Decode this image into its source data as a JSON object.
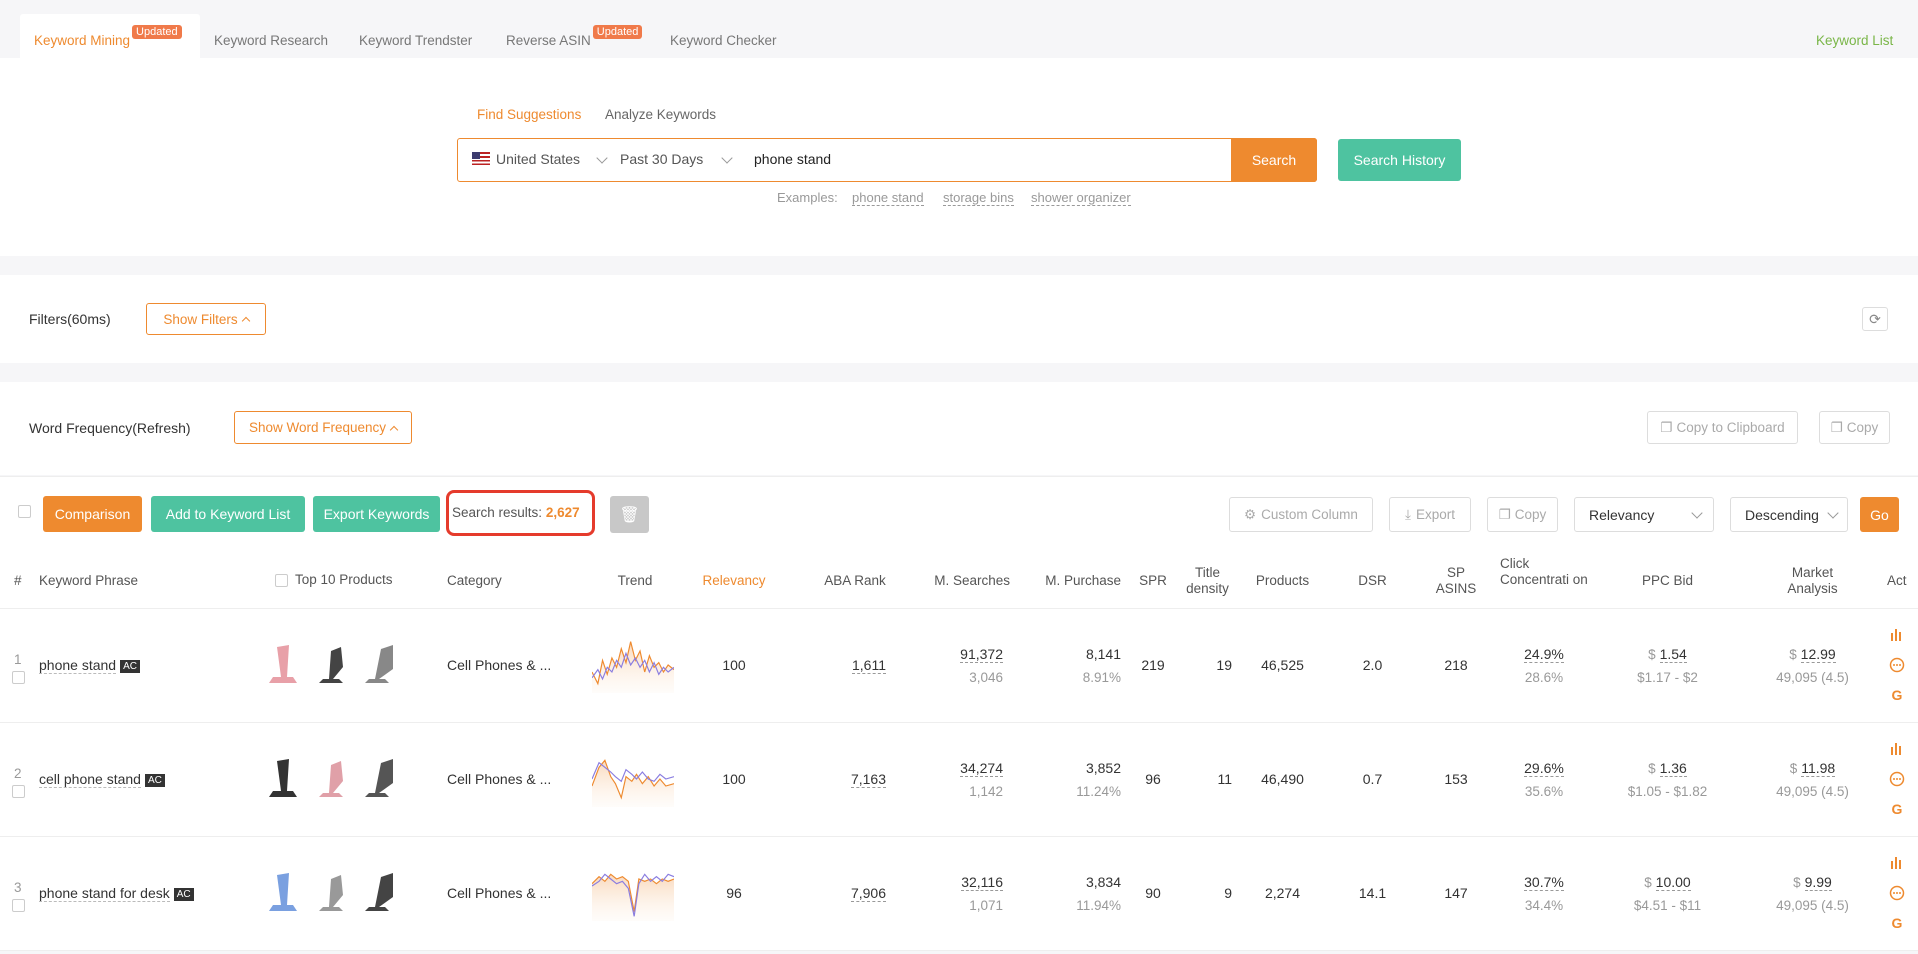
{
  "nav": {
    "tabs": [
      {
        "label": "Keyword Mining",
        "badge": "Updated"
      },
      {
        "label": "Keyword Research"
      },
      {
        "label": "Keyword Trendster"
      },
      {
        "label": "Reverse ASIN",
        "badge": "Updated"
      },
      {
        "label": "Keyword Checker"
      }
    ],
    "keyword_list": "Keyword List"
  },
  "search": {
    "subtabs": [
      "Find Suggestions",
      "Analyze Keywords"
    ],
    "country": "United States",
    "period": "Past 30 Days",
    "query": "phone stand",
    "search_label": "Search",
    "history_label": "Search History",
    "examples_label": "Examples:",
    "examples": [
      "phone stand",
      "storage bins",
      "shower organizer"
    ]
  },
  "filters": {
    "title": "Filters(60ms)",
    "show_label": "Show Filters"
  },
  "wordfreq": {
    "title": "Word Frequency(Refresh)",
    "show_label": "Show Word Frequency",
    "copy_clipboard": "Copy to Clipboard",
    "copy": "Copy"
  },
  "toolbar": {
    "comparison": "Comparison",
    "add_list": "Add to Keyword List",
    "export_keywords": "Export Keywords",
    "results_label": "Search results:",
    "results_count": "2,627",
    "custom_column": "Custom Column",
    "export": "Export",
    "copy": "Copy",
    "sort_by": "Relevancy",
    "order": "Descending",
    "go": "Go"
  },
  "table": {
    "headers": {
      "num": "#",
      "phrase": "Keyword Phrase",
      "top10": "Top 10 Products",
      "category": "Category",
      "trend": "Trend",
      "relevancy": "Relevancy",
      "aba": "ABA Rank",
      "msearch": "M. Searches",
      "mpurchase": "M. Purchase",
      "spr": "SPR",
      "title_density": "Title density",
      "products": "Products",
      "dsr": "DSR",
      "sp_asins": "SP ASINS",
      "click_conc": "Click Concentrati on",
      "ppc": "PPC Bid",
      "market": "Market Analysis",
      "act": "Act"
    },
    "rows": [
      {
        "num": "1",
        "phrase": "phone stand",
        "ac": "AC",
        "category": "Cell Phones & ...",
        "relevancy": "100",
        "aba": "1,611",
        "msearch": "91,372",
        "msearch_sub": "3,046",
        "mpurchase": "8,141",
        "mpurchase_sub": "8.91%",
        "spr": "219",
        "title_density": "19",
        "products": "46,525",
        "dsr": "2.0",
        "sp_asins": "218",
        "click": "24.9%",
        "click_sub": "28.6%",
        "ppc_cur": "$",
        "ppc": "1.54",
        "ppc_range": "$1.17 - $2",
        "market_cur": "$",
        "market": "12.99",
        "market_sub": "49,095 (4.5)"
      },
      {
        "num": "2",
        "phrase": "cell phone stand",
        "ac": "AC",
        "category": "Cell Phones & ...",
        "relevancy": "100",
        "aba": "7,163",
        "msearch": "34,274",
        "msearch_sub": "1,142",
        "mpurchase": "3,852",
        "mpurchase_sub": "11.24%",
        "spr": "96",
        "title_density": "11",
        "products": "46,490",
        "dsr": "0.7",
        "sp_asins": "153",
        "click": "29.6%",
        "click_sub": "35.6%",
        "ppc_cur": "$",
        "ppc": "1.36",
        "ppc_range": "$1.05 - $1.82",
        "market_cur": "$",
        "market": "11.98",
        "market_sub": "49,095 (4.5)"
      },
      {
        "num": "3",
        "phrase": "phone stand for desk",
        "ac": "AC",
        "category": "Cell Phones & ...",
        "relevancy": "96",
        "aba": "7,906",
        "msearch": "32,116",
        "msearch_sub": "1,071",
        "mpurchase": "3,834",
        "mpurchase_sub": "11.94%",
        "spr": "90",
        "title_density": "9",
        "products": "2,274",
        "dsr": "14.1",
        "sp_asins": "147",
        "click": "30.7%",
        "click_sub": "34.4%",
        "ppc_cur": "$",
        "ppc": "10.00",
        "ppc_range": "$4.51 - $11",
        "market_cur": "$",
        "market": "9.99",
        "market_sub": "49,095 (4.5)"
      }
    ]
  },
  "colors": {
    "accent": "#ee8a2f",
    "green": "#4ec3a0",
    "badge": "#f07a4a",
    "highlight": "#e53b2c"
  }
}
